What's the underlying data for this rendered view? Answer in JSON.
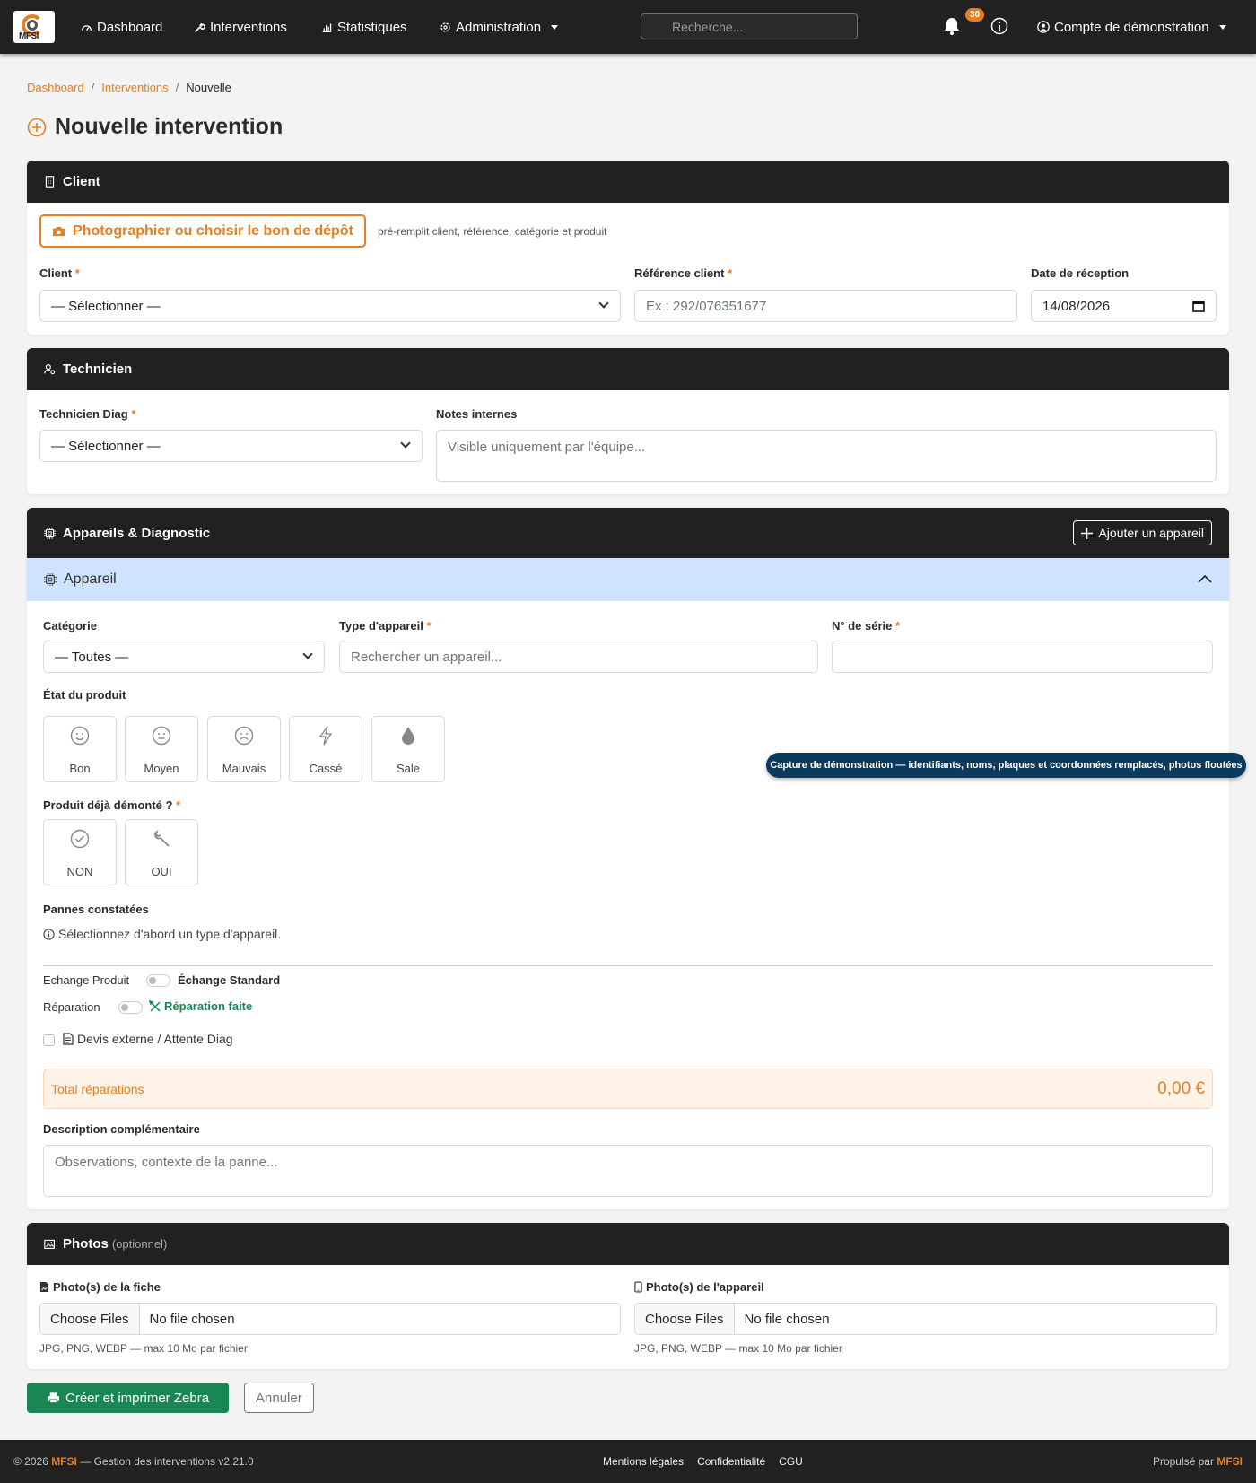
{
  "nav": {
    "brand": "MFSI",
    "links": [
      "Dashboard",
      "Interventions",
      "Statistiques",
      "Administration"
    ],
    "search_placeholder": "Recherche...",
    "notif_count": "30",
    "account": "Compte de démonstration"
  },
  "breadcrumb": [
    "Dashboard",
    "Interventions",
    "Nouvelle"
  ],
  "page_title": "Nouvelle intervention",
  "client": {
    "header": "Client",
    "photo_button": "Photographier ou choisir le bon de dépôt",
    "photo_hint": "pré-remplit client, référence, catégorie et produit",
    "client_label": "Client",
    "client_value": "— Sélectionner —",
    "ref_label": "Référence client",
    "ref_placeholder": "Ex : 292/076351677",
    "date_label": "Date de réception",
    "date_value": "14/08/2026"
  },
  "technicien": {
    "header": "Technicien",
    "tech_label": "Technicien Diag",
    "tech_value": "— Sélectionner —",
    "notes_label": "Notes internes",
    "notes_placeholder": "Visible uniquement par l'équipe..."
  },
  "appareils": {
    "header": "Appareils & Diagnostic",
    "add_button": "Ajouter un appareil",
    "device_title": "Appareil",
    "categorie_label": "Catégorie",
    "categorie_value": "— Toutes —",
    "type_label": "Type d'appareil",
    "type_placeholder": "Rechercher un appareil...",
    "serie_label": "N° de série",
    "etat_label": "État du produit",
    "etats": [
      "Bon",
      "Moyen",
      "Mauvais",
      "Cassé",
      "Sale"
    ],
    "demonte_label": "Produit déjà démonté ?",
    "demonte_options": [
      "NON",
      "OUI"
    ],
    "pannes_label": "Pannes constatées",
    "pannes_hint": "Sélectionnez d'abord un type d'appareil.",
    "echange_label": "Echange Produit",
    "echange_option": "Échange Standard",
    "reparation_label": "Réparation",
    "reparation_option": "Réparation faite",
    "devis_label": "Devis externe / Attente Diag",
    "total_label": "Total réparations",
    "total_value": "0,00 €",
    "desc_label": "Description complémentaire",
    "desc_placeholder": "Observations, contexte de la panne..."
  },
  "tooltip": "Capture de démonstration — identifiants, noms, plaques et coordonnées remplacés, photos floutées",
  "photos": {
    "header": "Photos",
    "header_optional": "(optionnel)",
    "fiche_label": "Photo(s) de la fiche",
    "appareil_label": "Photo(s) de l'appareil",
    "choose": "Choose Files",
    "no_file": "No file chosen",
    "hint": "JPG, PNG, WEBP — max 10 Mo par fichier"
  },
  "actions": {
    "create": "Créer et imprimer Zebra",
    "cancel": "Annuler"
  },
  "footer": {
    "left_prefix": "© 2026",
    "brand": "MFSI",
    "left_suffix": "— Gestion des interventions v2.21.0",
    "links": [
      "Mentions légales",
      "Confidentialité",
      "CGU"
    ],
    "right_prefix": "Propulsé par"
  },
  "colors": {
    "accent": "#e67e22",
    "dark": "#212121",
    "success": "#198754",
    "device_header": "#cfe2ff"
  }
}
